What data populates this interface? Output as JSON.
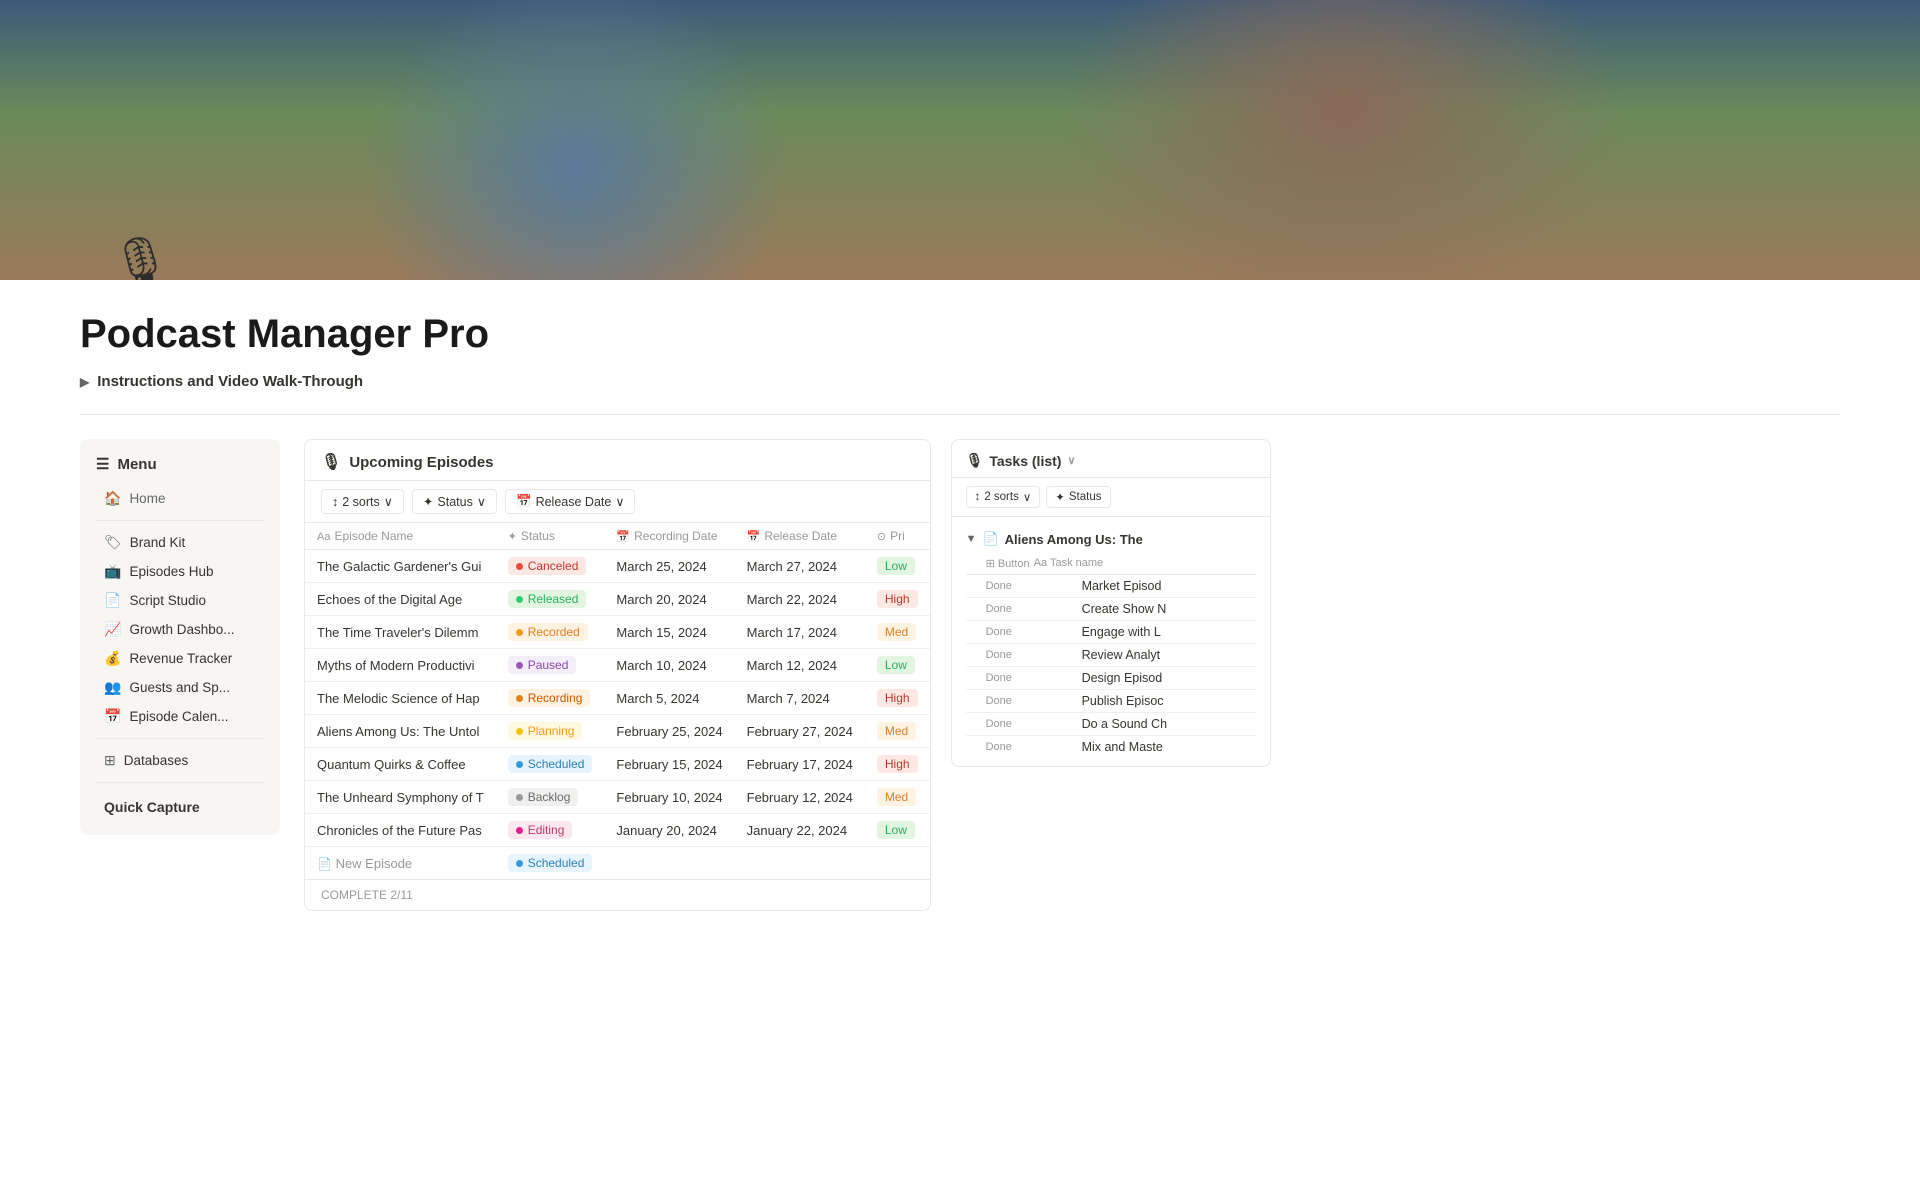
{
  "hero": {
    "alt": "Podcast studio with two people using microphones"
  },
  "page": {
    "title": "Podcast Manager Pro",
    "instructions_label": "Instructions and Video Walk-Through"
  },
  "sidebar": {
    "menu_label": "Menu",
    "home_label": "Home",
    "items": [
      {
        "id": "brand-kit",
        "icon": "🏷",
        "label": "Brand Kit"
      },
      {
        "id": "episodes-hub",
        "icon": "📺",
        "label": "Episodes Hub"
      },
      {
        "id": "script-studio",
        "icon": "📄",
        "label": "Script Studio"
      },
      {
        "id": "growth-dashboard",
        "icon": "📈",
        "label": "Growth Dashbo..."
      },
      {
        "id": "revenue-tracker",
        "icon": "💰",
        "label": "Revenue Tracker"
      },
      {
        "id": "guests-speakers",
        "icon": "👥",
        "label": "Guests and Sp..."
      },
      {
        "id": "episode-calendar",
        "icon": "📅",
        "label": "Episode Calen..."
      }
    ],
    "databases_label": "Databases",
    "quick_capture_label": "Quick Capture"
  },
  "upcoming_episodes": {
    "title": "Upcoming Episodes",
    "title_icon": "🎙",
    "filters": [
      {
        "id": "sorts",
        "label": "2 sorts",
        "icon": "↕"
      },
      {
        "id": "status",
        "label": "Status",
        "icon": "✦"
      },
      {
        "id": "release-date",
        "label": "Release Date",
        "icon": "📅"
      }
    ],
    "columns": [
      {
        "id": "episode-name",
        "icon": "Aa",
        "label": "Episode Name"
      },
      {
        "id": "status",
        "icon": "✦",
        "label": "Status"
      },
      {
        "id": "recording-date",
        "icon": "📅",
        "label": "Recording Date"
      },
      {
        "id": "release-date",
        "icon": "📅",
        "label": "Release Date"
      },
      {
        "id": "priority",
        "icon": "⊙",
        "label": "Pri"
      }
    ],
    "episodes": [
      {
        "name": "The Galactic Gardener's Gui",
        "status": "Canceled",
        "status_class": "status-canceled",
        "recording_date": "March 25, 2024",
        "release_date": "March 27, 2024",
        "priority": "Low",
        "priority_class": "priority-low"
      },
      {
        "name": "Echoes of the Digital Age",
        "status": "Released",
        "status_class": "status-released",
        "recording_date": "March 20, 2024",
        "release_date": "March 22, 2024",
        "priority": "High",
        "priority_class": "priority-high"
      },
      {
        "name": "The Time Traveler's Dilemm",
        "status": "Recorded",
        "status_class": "status-recorded",
        "recording_date": "March 15, 2024",
        "release_date": "March 17, 2024",
        "priority": "Med",
        "priority_class": "priority-med"
      },
      {
        "name": "Myths of Modern Productivi",
        "status": "Paused",
        "status_class": "status-paused",
        "recording_date": "March 10, 2024",
        "release_date": "March 12, 2024",
        "priority": "Low",
        "priority_class": "priority-low"
      },
      {
        "name": "The Melodic Science of Hap",
        "status": "Recording",
        "status_class": "status-recording",
        "recording_date": "March 5, 2024",
        "release_date": "March 7, 2024",
        "priority": "High",
        "priority_class": "priority-high"
      },
      {
        "name": "Aliens Among Us: The Untol",
        "status": "Planning",
        "status_class": "status-planning",
        "recording_date": "February 25, 2024",
        "release_date": "February 27, 2024",
        "priority": "Med",
        "priority_class": "priority-med"
      },
      {
        "name": "Quantum Quirks & Coffee",
        "status": "Scheduled",
        "status_class": "status-scheduled",
        "recording_date": "February 15, 2024",
        "release_date": "February 17, 2024",
        "priority": "High",
        "priority_class": "priority-high"
      },
      {
        "name": "The Unheard Symphony of T",
        "status": "Backlog",
        "status_class": "status-backlog",
        "recording_date": "February 10, 2024",
        "release_date": "February 12, 2024",
        "priority": "Med",
        "priority_class": "priority-med"
      },
      {
        "name": "Chronicles of the Future Pas",
        "status": "Editing",
        "status_class": "status-editing",
        "recording_date": "January 20, 2024",
        "release_date": "January 22, 2024",
        "priority": "Low",
        "priority_class": "priority-low"
      }
    ],
    "new_episode_label": "New Episode",
    "new_episode_status": "Scheduled",
    "new_episode_status_class": "status-scheduled",
    "complete_label": "COMPLETE 2/11"
  },
  "tasks": {
    "title": "Tasks (list)",
    "title_icon": "🎙",
    "filters": [
      {
        "id": "sorts",
        "label": "2 sorts",
        "icon": "↕"
      },
      {
        "id": "status",
        "label": "Status",
        "icon": "✦"
      }
    ],
    "group_title": "Aliens Among Us: The",
    "columns": [
      {
        "id": "button",
        "label": "Button"
      },
      {
        "id": "task-name",
        "label": "Aa Task name"
      }
    ],
    "tasks": [
      {
        "done": "Done",
        "button": "",
        "name": "Market Episod"
      },
      {
        "done": "Done",
        "button": "",
        "name": "Create Show N"
      },
      {
        "done": "Done",
        "button": "",
        "name": "Engage with L"
      },
      {
        "done": "Done",
        "button": "",
        "name": "Review Analyt"
      },
      {
        "done": "Done",
        "button": "",
        "name": "Design Episod"
      },
      {
        "done": "Done",
        "button": "",
        "name": "Publish Episoc"
      },
      {
        "done": "Done",
        "button": "",
        "name": "Do a Sound Ch"
      },
      {
        "done": "Done",
        "button": "",
        "name": "Mix and Maste"
      }
    ]
  }
}
